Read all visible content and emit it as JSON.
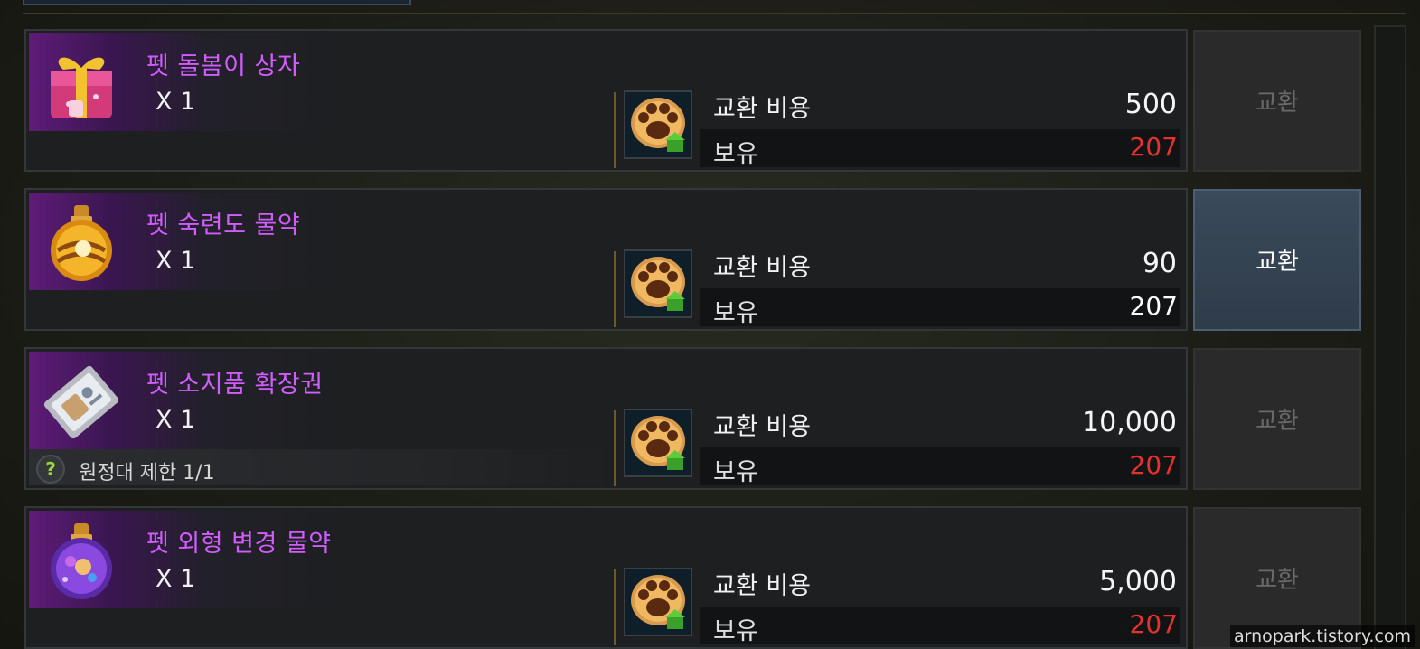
{
  "rows": [
    {
      "name": "펫 돌봄이 상자",
      "qty": "X 1",
      "icon": "gift-box-icon",
      "cost_label": "교환 비용",
      "cost": "500",
      "own_label": "보유",
      "own": "207",
      "own_color": "#e5322e",
      "button_label": "교환",
      "button_enabled": false
    },
    {
      "name": "펫 숙련도 물약",
      "qty": "X 1",
      "icon": "orange-potion-icon",
      "cost_label": "교환 비용",
      "cost": "90",
      "own_label": "보유",
      "own": "207",
      "own_color": "#ffffff",
      "button_label": "교환",
      "button_enabled": true
    },
    {
      "name": "펫 소지품 확장권",
      "qty": "X 1",
      "icon": "ticket-icon",
      "limit_text": "원정대 제한 1/1",
      "cost_label": "교환 비용",
      "cost": "10,000",
      "own_label": "보유",
      "own": "207",
      "own_color": "#e5322e",
      "button_label": "교환",
      "button_enabled": false
    },
    {
      "name": "펫 외형 변경 물약",
      "qty": "X 1",
      "icon": "purple-potion-icon",
      "cost_label": "교환 비용",
      "cost": "5,000",
      "own_label": "보유",
      "own": "207",
      "own_color": "#e5322e",
      "button_label": "교환",
      "button_enabled": false
    }
  ],
  "limit_help_icon": "?",
  "currency_icon": "paw-cookie-icon",
  "watermark": "arnopark.tistory.com",
  "colors": {
    "item_name": "#d15dff",
    "insufficient": "#e5322e",
    "active_button": "#3a4a5a"
  }
}
